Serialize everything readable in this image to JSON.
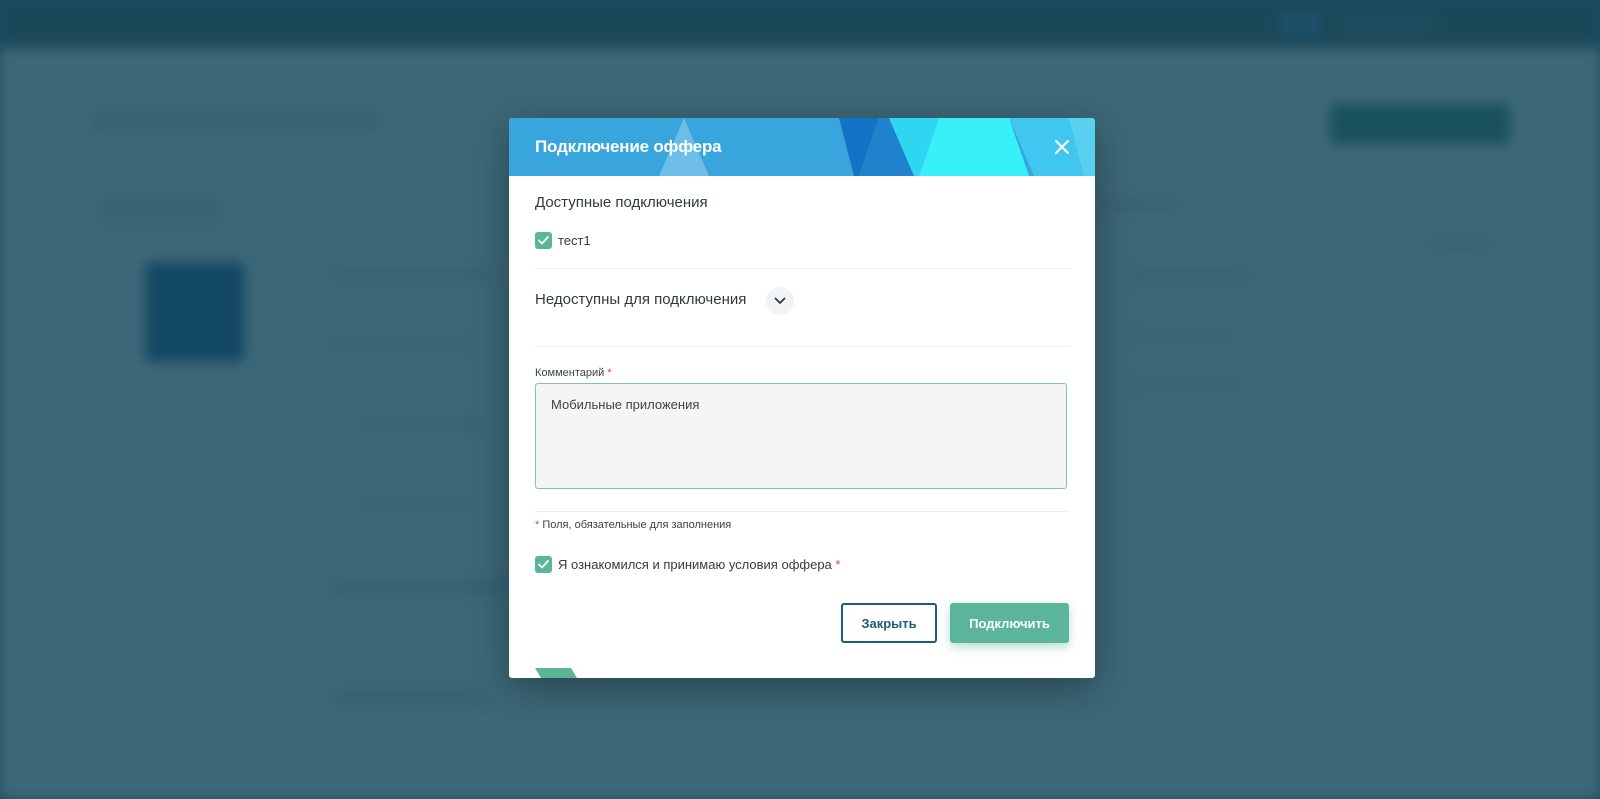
{
  "modal": {
    "title": "Подключение оффера",
    "available_title": "Доступные подключения",
    "available_items": [
      {
        "label": "тест1",
        "checked": true
      }
    ],
    "unavailable_title": "Недоступны для подключения",
    "comment_label": "Комментарий",
    "required_mark": "*",
    "comment_value": "Мобильные приложения",
    "required_note": "Поля, обязательные для заполнения",
    "agree_label": "Я ознакомился и принимаю условия оффера",
    "agree_checked": true,
    "close_button": "Закрыть",
    "connect_button": "Подключить"
  },
  "colors": {
    "header": "#39a5dd",
    "accent_green": "#5bb59a",
    "close_button_border": "#1f5b7a",
    "overlay": "#15485c",
    "required": "#e0413a"
  },
  "icons": {
    "close": "close-icon",
    "check": "check-icon",
    "chevron": "chevron-down-icon"
  }
}
